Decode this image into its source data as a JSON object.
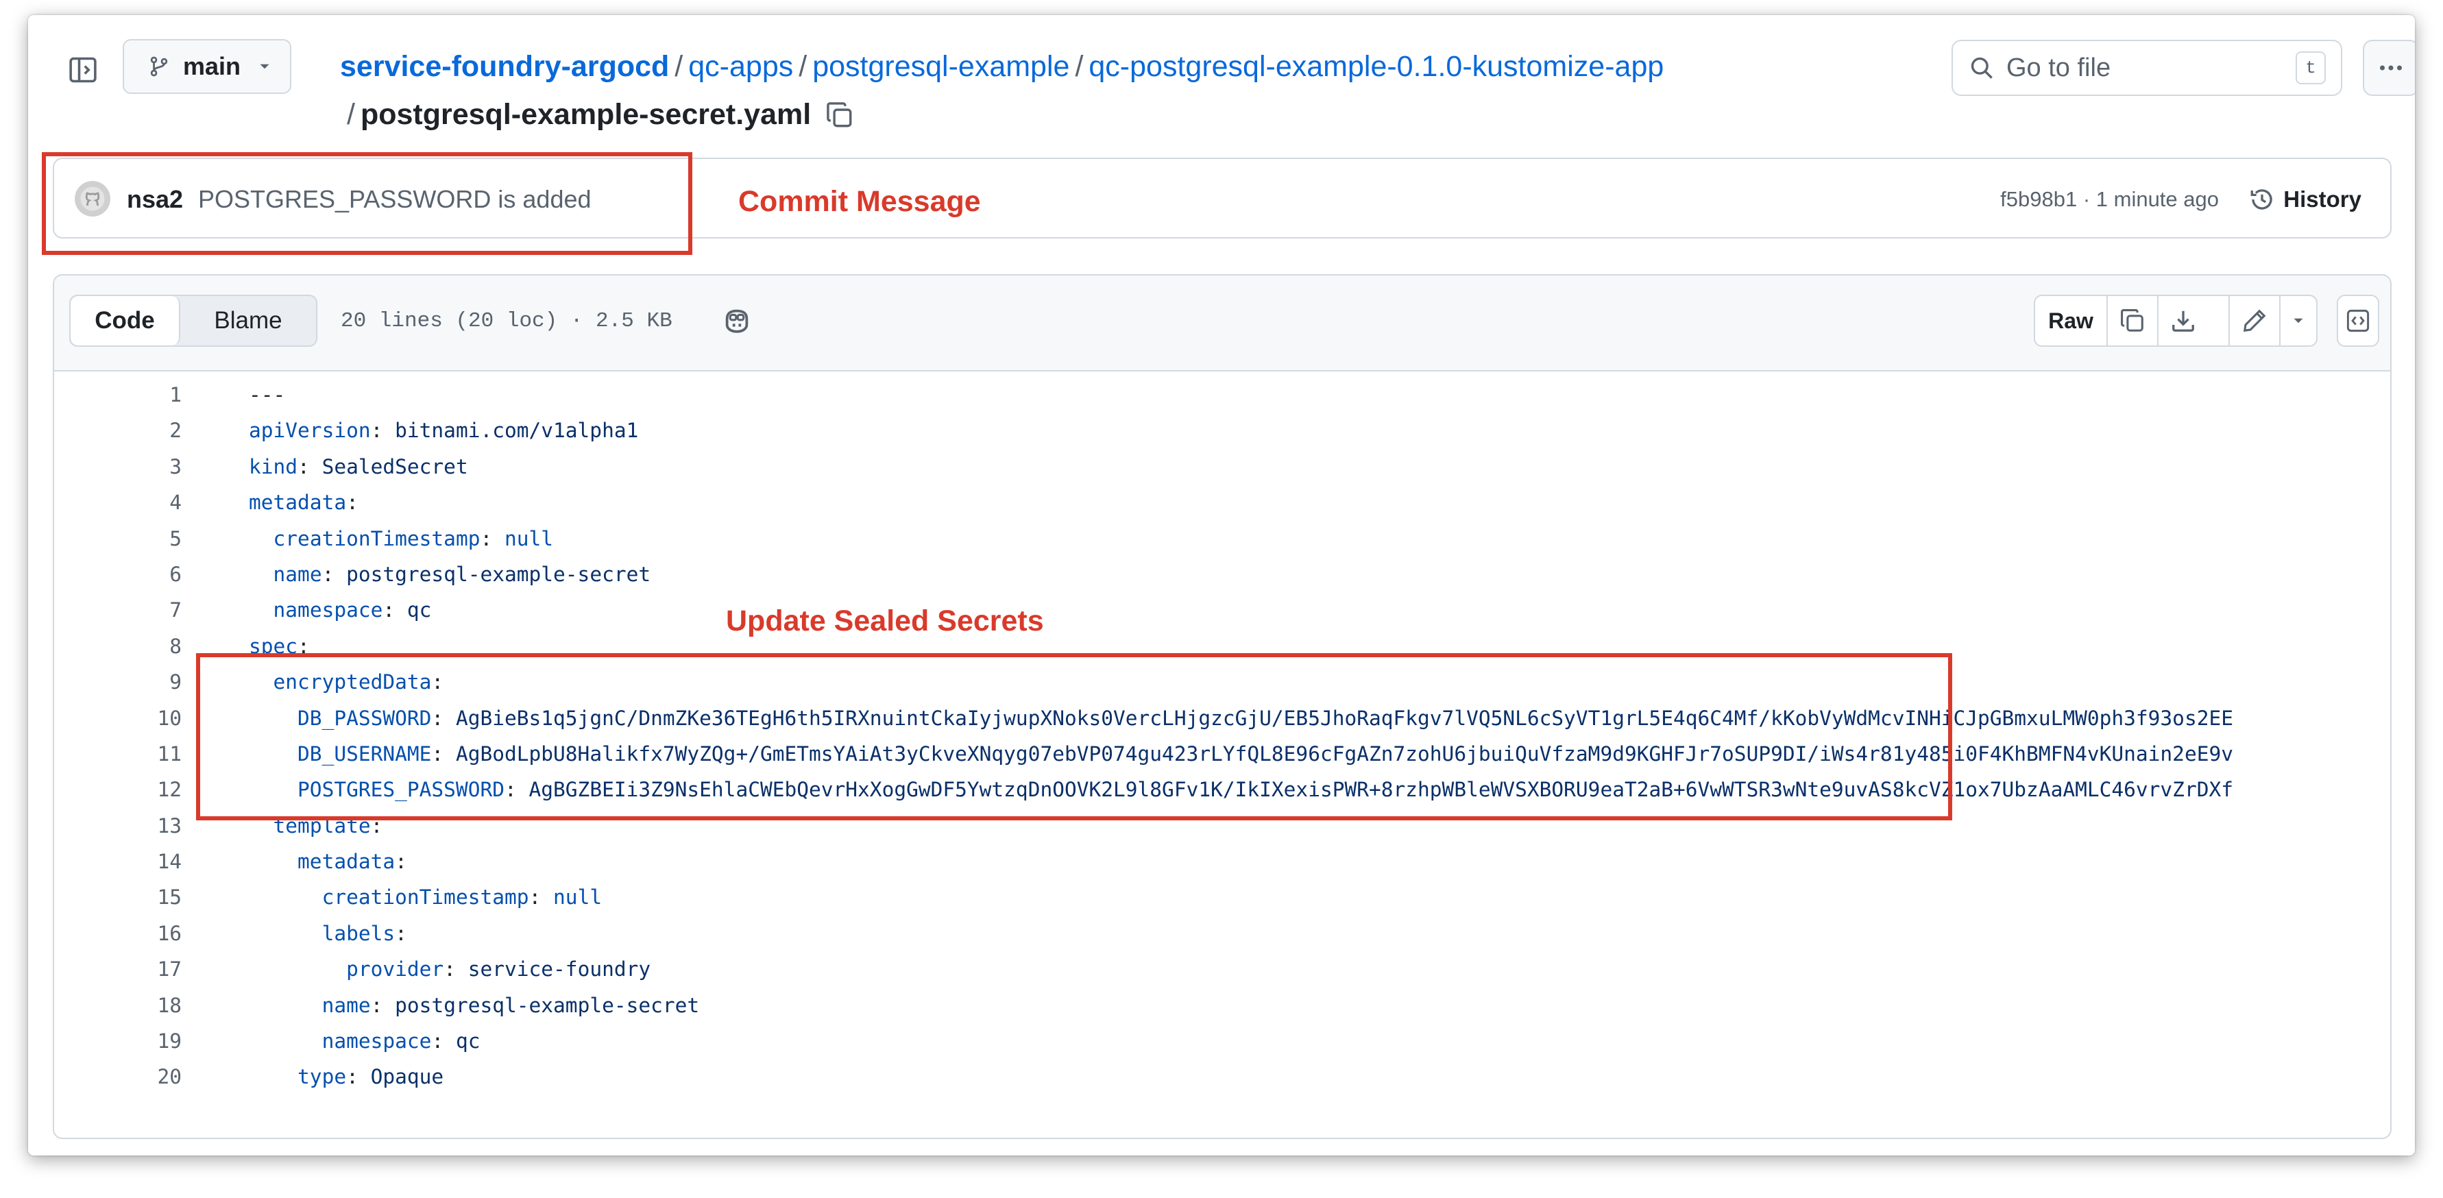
{
  "header": {
    "branch": "main",
    "breadcrumb": {
      "root": "service-foundry-argocd",
      "parts": [
        "qc-apps",
        "postgresql-example",
        "qc-postgresql-example-0.1.0-kustomize-app"
      ],
      "separator": "/",
      "file": "postgresql-example-secret.yaml"
    },
    "search_placeholder": "Go to file",
    "search_shortcut": "t"
  },
  "commit": {
    "author": "nsa2",
    "message": "POSTGRES_PASSWORD is added",
    "meta": "f5b98b1 · 1 minute ago",
    "history_label": "History"
  },
  "annotations": {
    "commit_label": "Commit Message",
    "secrets_label": "Update Sealed Secrets",
    "color": "#d93a2b"
  },
  "file": {
    "tabs": [
      "Code",
      "Blame"
    ],
    "info": "20 lines (20 loc) · 2.5 KB",
    "raw_label": "Raw",
    "lines": [
      {
        "n": "1",
        "indent": "",
        "key": "",
        "sep": "",
        "val": "---",
        "vclass": "p"
      },
      {
        "n": "2",
        "indent": "",
        "key": "apiVersion",
        "sep": ": ",
        "val": "bitnami.com/v1alpha1",
        "vclass": "v"
      },
      {
        "n": "3",
        "indent": "",
        "key": "kind",
        "sep": ": ",
        "val": "SealedSecret",
        "vclass": "v"
      },
      {
        "n": "4",
        "indent": "",
        "key": "metadata",
        "sep": ":",
        "val": "",
        "vclass": "v"
      },
      {
        "n": "5",
        "indent": "  ",
        "key": "creationTimestamp",
        "sep": ": ",
        "val": "null",
        "vclass": "n"
      },
      {
        "n": "6",
        "indent": "  ",
        "key": "name",
        "sep": ": ",
        "val": "postgresql-example-secret",
        "vclass": "v"
      },
      {
        "n": "7",
        "indent": "  ",
        "key": "namespace",
        "sep": ": ",
        "val": "qc",
        "vclass": "v"
      },
      {
        "n": "8",
        "indent": "",
        "key": "spec",
        "sep": ":",
        "val": "",
        "vclass": "v"
      },
      {
        "n": "9",
        "indent": "  ",
        "key": "encryptedData",
        "sep": ":",
        "val": "",
        "vclass": "v"
      },
      {
        "n": "10",
        "indent": "    ",
        "key": "DB_PASSWORD",
        "sep": ": ",
        "val": "AgBieBs1q5jgnC/DnmZKe36TEgH6th5IRXnuintCkaIyjwupXNoks0VercLHjgzcGjU/EB5JhoRaqFkgv7lVQ5NL6cSyVT1grL5E4q6C4Mf/kKobVyWdMcvINHiCJpGBmxuLMW0ph3f93os2EE",
        "vclass": "v"
      },
      {
        "n": "11",
        "indent": "    ",
        "key": "DB_USERNAME",
        "sep": ": ",
        "val": "AgBodLpbU8Halikfx7WyZQg+/GmETmsYAiAt3yCkveXNqyg07ebVP074gu423rLYfQL8E96cFgAZn7zohU6jbuiQuVfzaM9d9KGHFJr7oSUP9DI/iWs4r81y485i0F4KhBMFN4vKUnain2eE9v",
        "vclass": "v"
      },
      {
        "n": "12",
        "indent": "    ",
        "key": "POSTGRES_PASSWORD",
        "sep": ": ",
        "val": "AgBGZBEIi3Z9NsEhlaCWEbQevrHxXogGwDF5YwtzqDnOOVK2L9l8GFv1K/IkIXexisPWR+8rzhpWBleWVSXBORU9eaT2aB+6VwWTSR3wNte9uvAS8kcVZ1ox7UbzAaAMLC46vrvZrDXf",
        "vclass": "v"
      },
      {
        "n": "13",
        "indent": "  ",
        "key": "template",
        "sep": ":",
        "val": "",
        "vclass": "v"
      },
      {
        "n": "14",
        "indent": "    ",
        "key": "metadata",
        "sep": ":",
        "val": "",
        "vclass": "v"
      },
      {
        "n": "15",
        "indent": "      ",
        "key": "creationTimestamp",
        "sep": ": ",
        "val": "null",
        "vclass": "n"
      },
      {
        "n": "16",
        "indent": "      ",
        "key": "labels",
        "sep": ":",
        "val": "",
        "vclass": "v"
      },
      {
        "n": "17",
        "indent": "        ",
        "key": "provider",
        "sep": ": ",
        "val": "service-foundry",
        "vclass": "v"
      },
      {
        "n": "18",
        "indent": "      ",
        "key": "name",
        "sep": ": ",
        "val": "postgresql-example-secret",
        "vclass": "v"
      },
      {
        "n": "19",
        "indent": "      ",
        "key": "namespace",
        "sep": ": ",
        "val": "qc",
        "vclass": "v"
      },
      {
        "n": "20",
        "indent": "    ",
        "key": "type",
        "sep": ": ",
        "val": "Opaque",
        "vclass": "v"
      }
    ]
  }
}
